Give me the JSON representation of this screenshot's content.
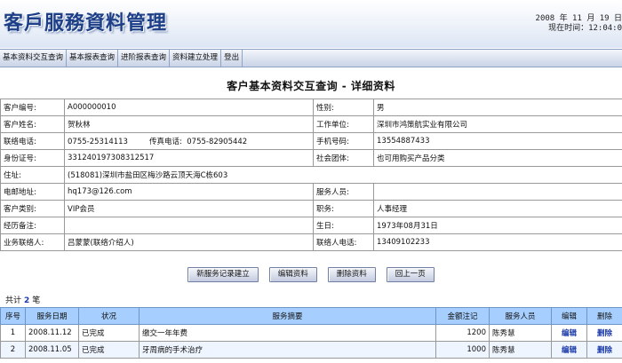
{
  "header": {
    "title": "客戶服務資料管理",
    "date_line": "2008 年 11 月 19 日",
    "time_line": "现在时间：12:04:0"
  },
  "menu": [
    {
      "label": "基本资料交互查询"
    },
    {
      "label": "基本报表查询"
    },
    {
      "label": "进阶报表查询"
    },
    {
      "label": "资料建立处理"
    },
    {
      "label": "登出"
    }
  ],
  "page_title": "客户基本资料交互查询 - 详细资料",
  "detail": {
    "customer_no_label": "客户编号:",
    "customer_no": "A000000010",
    "gender_label": "性别:",
    "gender": "男",
    "name_label": "客户姓名:",
    "name": "贺秋林",
    "company_label": "工作单位:",
    "company": "深圳市鸿策航实业有限公司",
    "phone_label": "联络电话:",
    "phone": "0755-25314113",
    "fax_label": "传真电话:",
    "fax": "0755-82905442",
    "mobile_label": "手机号码:",
    "mobile": "13554887433",
    "id_label": "身份证号:",
    "id": "331240197308312517",
    "group_label": "社会团体:",
    "group": "也可用购买产品分类",
    "address_label": "住址:",
    "address": "(518081)深圳市盐田区梅沙路云顶天海C栋603",
    "email_label": "电邮地址:",
    "email": "hq173@126.com",
    "service_staff_label": "服务人员:",
    "service_staff": "",
    "category_label": "客户类别:",
    "category": "VIP会员",
    "position_label": "职务:",
    "position": "人事经理",
    "history_label": "经历备注:",
    "history": "",
    "birthday_label": "生日:",
    "birthday": "1973年08月31日",
    "contact_label": "业务联络人:",
    "contact": "吕蒙蒙(联络介绍人)",
    "contact_phone_label": "联络人电话:",
    "contact_phone": "13409102233"
  },
  "buttons": {
    "new_record": "新服务记录建立",
    "edit": "编辑资料",
    "delete": "删除资料",
    "back": "回上一页"
  },
  "count": {
    "prefix": "共计",
    "value": "2",
    "suffix": "笔"
  },
  "records": {
    "columns": [
      "序号",
      "服务日期",
      "状况",
      "服务摘要",
      "金额注记",
      "服务人员",
      "编辑",
      "删除"
    ],
    "rows": [
      {
        "no": "1",
        "date": "2008.11.12",
        "status": "已完成",
        "summary": "缴交一年年费",
        "amount": "1200",
        "staff": "陈秀慧",
        "edit": "编辑",
        "delete": "删除"
      },
      {
        "no": "2",
        "date": "2008.11.05",
        "status": "已完成",
        "summary": "牙周病的手术治疗",
        "amount": "1000",
        "staff": "陈秀慧",
        "edit": "编辑",
        "delete": "删除"
      }
    ]
  },
  "colors": {
    "header_blue": "#1d3f87",
    "table_header": "#a6cfff",
    "link": "#1a39a8"
  }
}
